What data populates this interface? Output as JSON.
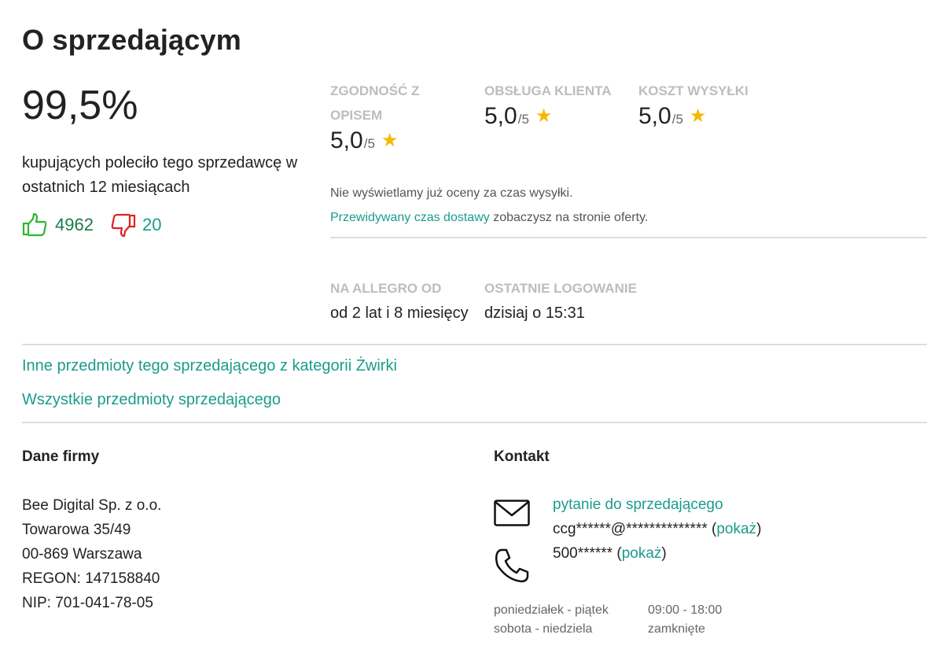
{
  "title": "O sprzedającym",
  "rating": {
    "percent": "99,5%",
    "recommend_text": "kupujących poleciło tego sprzedawcę w ostatnich 12 miesiącach",
    "positive_count": "4962",
    "negative_count": "20"
  },
  "metrics": [
    {
      "label": "ZGODNOŚĆ Z OPISEM",
      "value": "5,0",
      "max": "/5"
    },
    {
      "label": "OBSŁUGA KLIENTA",
      "value": "5,0",
      "max": "/5"
    },
    {
      "label": "KOSZT WYSYŁKI",
      "value": "5,0",
      "max": "/5"
    }
  ],
  "shipping_note": {
    "line1": "Nie wyświetlamy już oceny za czas wysyłki.",
    "link": "Przewidywany czas dostawy",
    "rest": " zobaczysz na stronie oferty."
  },
  "seller_info": {
    "since_label": "NA ALLEGRO OD",
    "since_value": "od 2 lat i 8 miesięcy",
    "login_label": "OSTATNIE LOGOWANIE",
    "login_value": "dzisiaj o 15:31"
  },
  "links": {
    "category_items": "Inne przedmioty tego sprzedającego z kategorii Żwirki",
    "all_items": "Wszystkie przedmioty sprzedającego"
  },
  "company": {
    "heading": "Dane firmy",
    "name": "Bee Digital Sp. z o.o.",
    "street": "Towarowa 35/49",
    "city": "00-869 Warszawa",
    "regon": "REGON: 147158840",
    "nip": "NIP: 701-041-78-05"
  },
  "contact": {
    "heading": "Kontakt",
    "question_link": "pytanie do sprzedającego",
    "email_masked": "ccg******@**************",
    "phone_masked": "500******",
    "show_label": "pokaż",
    "hours": [
      {
        "days": "poniedziałek - piątek",
        "time": "09:00 - 18:00"
      },
      {
        "days": "sobota - niedziela",
        "time": "zamknięte"
      }
    ]
  },
  "colors": {
    "link": "#1a9c8c",
    "thumb_up": "#2eb82e",
    "thumb_down": "#e02020",
    "star": "#f5b800"
  },
  "icons": {
    "thumb_up": "thumbs-up-icon",
    "thumb_down": "thumbs-down-icon",
    "star": "star-icon",
    "mail": "envelope-icon",
    "phone": "phone-icon"
  }
}
